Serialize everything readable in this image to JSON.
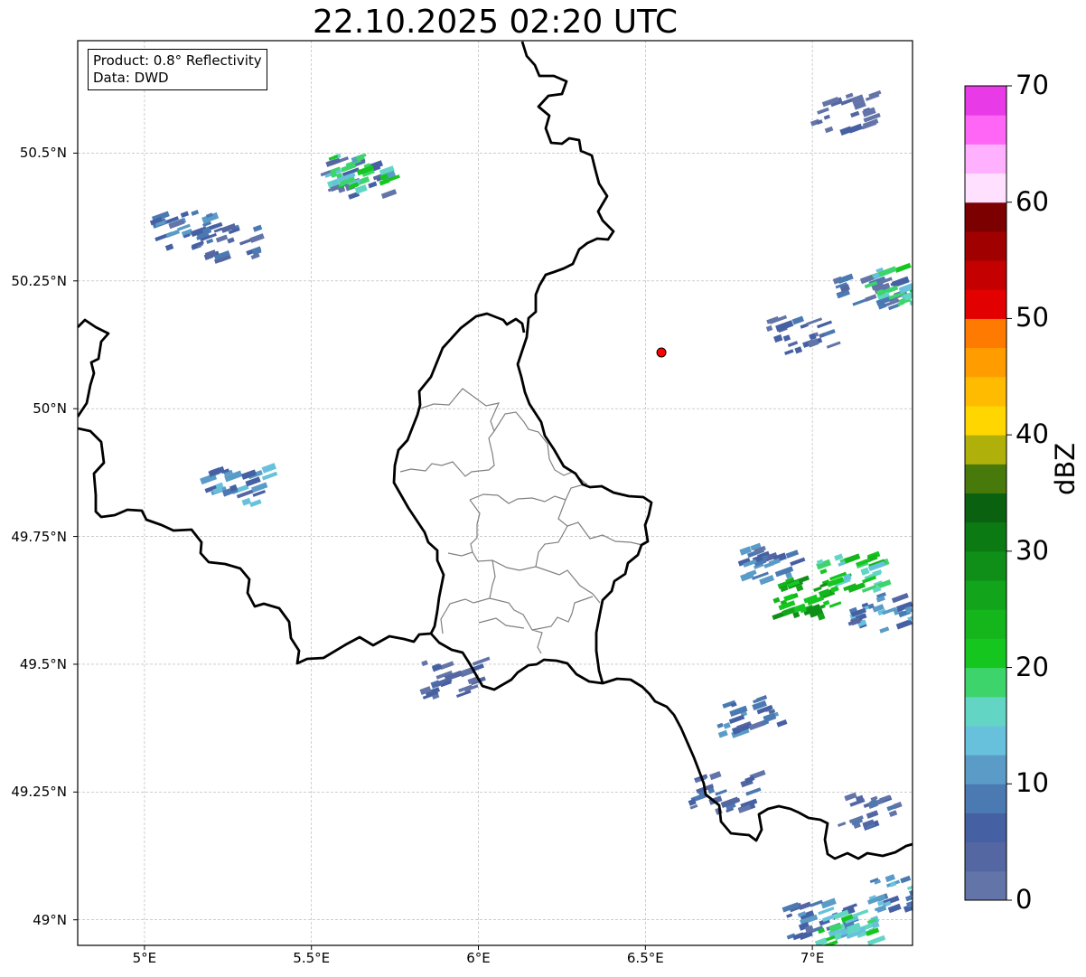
{
  "title": "22.10.2025 02:20 UTC",
  "info": {
    "product": "Product: 0.8° Reflectivity",
    "source": "Data: DWD"
  },
  "map": {
    "extent": {
      "lon": [
        4.8,
        7.3
      ],
      "lat": [
        48.95,
        50.72
      ]
    },
    "grid": true,
    "lon_ticks": [
      {
        "value": 5.0,
        "label": "5°E"
      },
      {
        "value": 5.5,
        "label": "5.5°E"
      },
      {
        "value": 6.0,
        "label": "6°E"
      },
      {
        "value": 6.5,
        "label": "6.5°E"
      },
      {
        "value": 7.0,
        "label": "7°E"
      }
    ],
    "lat_ticks": [
      {
        "value": 50.5,
        "label": "50.5°N"
      },
      {
        "value": 50.25,
        "label": "50.25°N"
      },
      {
        "value": 50.0,
        "label": "50°N"
      },
      {
        "value": 49.75,
        "label": "49.75°N"
      },
      {
        "value": 49.5,
        "label": "49.5°N"
      },
      {
        "value": 49.25,
        "label": "49.25°N"
      },
      {
        "value": 49.0,
        "label": "49°N"
      }
    ],
    "radar_site_marker": {
      "lon": 6.548,
      "lat": 50.11,
      "color": "#ff0000"
    }
  },
  "colorbar": {
    "unit": "dBZ",
    "ticks": [
      "0",
      "10",
      "20",
      "30",
      "40",
      "50",
      "60",
      "70"
    ],
    "colors": [
      "#6374a8",
      "#5467a2",
      "#4660a4",
      "#4b79b2",
      "#5a9cc7",
      "#68c1dc",
      "#62d5c4",
      "#3dd46b",
      "#15c61f",
      "#14b61c",
      "#12a41a",
      "#0f8f17",
      "#0c7a13",
      "#0a6210",
      "#477a0a",
      "#b0b00a",
      "#ffd600",
      "#ffbb00",
      "#ff9d00",
      "#ff7a00",
      "#e30000",
      "#c40000",
      "#a10000",
      "#7d0000",
      "#ffe0ff",
      "#ffb0ff",
      "#ff66f6",
      "#e83ae6"
    ]
  },
  "radar_echoes": [
    {
      "lon": 5.62,
      "lat": 50.45,
      "dbz": 8
    },
    {
      "lon": 5.63,
      "lat": 50.46,
      "dbz": 22
    },
    {
      "lon": 5.1,
      "lat": 50.35,
      "dbz": 12
    },
    {
      "lon": 5.23,
      "lat": 50.32,
      "dbz": 10
    },
    {
      "lon": 5.26,
      "lat": 49.85,
      "dbz": 14
    },
    {
      "lon": 5.9,
      "lat": 49.47,
      "dbz": 8
    },
    {
      "lon": 7.08,
      "lat": 50.58,
      "dbz": 6
    },
    {
      "lon": 7.15,
      "lat": 50.22,
      "dbz": 10
    },
    {
      "lon": 7.25,
      "lat": 50.24,
      "dbz": 22
    },
    {
      "lon": 6.95,
      "lat": 50.14,
      "dbz": 8
    },
    {
      "lon": 6.85,
      "lat": 49.7,
      "dbz": 12
    },
    {
      "lon": 6.97,
      "lat": 49.63,
      "dbz": 30
    },
    {
      "lon": 7.1,
      "lat": 49.68,
      "dbz": 24
    },
    {
      "lon": 7.2,
      "lat": 49.6,
      "dbz": 14
    },
    {
      "lon": 6.8,
      "lat": 49.4,
      "dbz": 12
    },
    {
      "lon": 6.72,
      "lat": 49.25,
      "dbz": 10
    },
    {
      "lon": 7.15,
      "lat": 49.22,
      "dbz": 9
    },
    {
      "lon": 7.0,
      "lat": 49.0,
      "dbz": 12
    },
    {
      "lon": 7.1,
      "lat": 48.98,
      "dbz": 22
    },
    {
      "lon": 7.25,
      "lat": 49.05,
      "dbz": 16
    }
  ]
}
